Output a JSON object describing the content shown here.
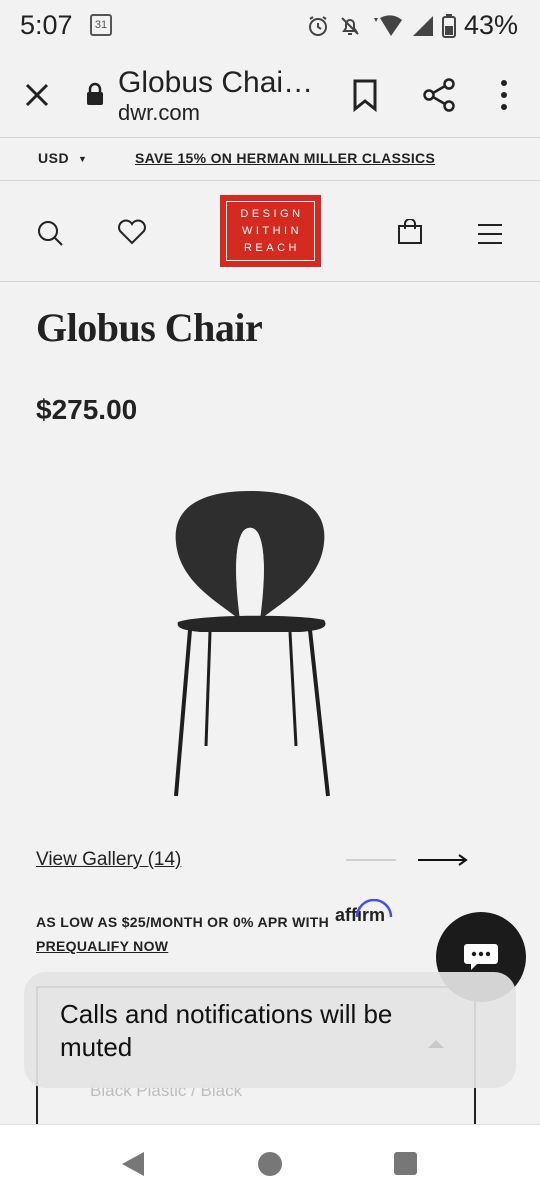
{
  "status_bar": {
    "time": "5:07",
    "calendar_day": "31",
    "battery": "43%"
  },
  "browser": {
    "page_title": "Globus Chai…",
    "domain": "dwr.com"
  },
  "promo": {
    "currency": "USD",
    "message": "SAVE 15% ON HERMAN MILLER CLASSICS"
  },
  "logo": {
    "line1": "DESIGN",
    "line2": "WITHIN",
    "line3": "REACH",
    "color": "#d42a20"
  },
  "product": {
    "title": "Globus Chair",
    "price": "$275.00",
    "gallery_link": "View Gallery (14)",
    "financing_text": "AS LOW AS $25/MONTH OR 0% APR WITH",
    "financing_brand": "affirm",
    "prequalify": "PREQUALIFY NOW",
    "selected_option": "Black Plastic / Black"
  },
  "toast": {
    "message": "Calls and notifications will be muted"
  },
  "icons": {
    "close": "close-icon",
    "lock": "lock-icon",
    "bookmark": "bookmark-icon",
    "share": "share-icon",
    "more": "more-vert-icon",
    "search": "search-icon",
    "wishlist": "heart-icon",
    "bag": "shopping-bag-icon",
    "menu": "hamburger-menu-icon",
    "chat": "chat-icon"
  }
}
